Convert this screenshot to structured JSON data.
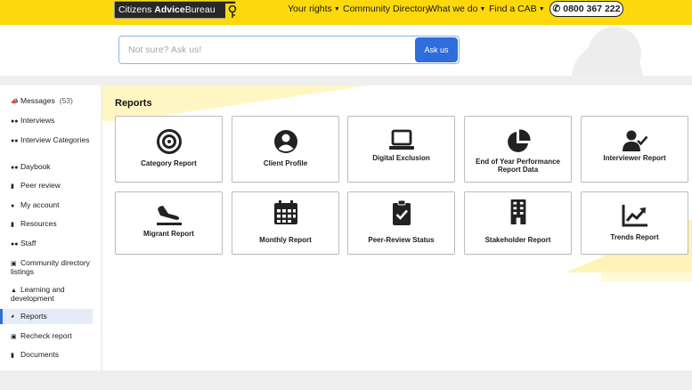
{
  "header": {
    "logo_light": "Citizens ",
    "logo_bold": "Advice",
    "logo_rest": "Bureau",
    "nav": [
      {
        "label": "Your rights",
        "dropdown": true
      },
      {
        "label": "Community Directory",
        "dropdown": false
      },
      {
        "label": "What we do",
        "dropdown": true
      },
      {
        "label": "Find a CAB",
        "dropdown": true
      }
    ],
    "phone": "0800 367 222",
    "colors": {
      "brand_yellow": "#fdd90b",
      "accent_blue": "#2f6ddc"
    }
  },
  "search": {
    "placeholder": "Not sure? Ask us!",
    "value": "",
    "button_label": "Ask us"
  },
  "sidebar": {
    "items": [
      {
        "label": "Messages",
        "count": "(53)",
        "icon": "megaphone-icon",
        "active": false
      },
      {
        "label": "Interviews",
        "icon": "users-icon",
        "active": false
      },
      {
        "label": "Interview Categories",
        "icon": "users-icon",
        "active": false
      },
      {
        "label": "Daybook",
        "icon": "users-icon",
        "active": false
      },
      {
        "label": "Peer review",
        "icon": "clipboard-icon",
        "active": false
      },
      {
        "label": "My account",
        "icon": "user-icon",
        "active": false
      },
      {
        "label": "Resources",
        "icon": "file-icon",
        "active": false
      },
      {
        "label": "Staff",
        "icon": "users-icon",
        "active": false
      },
      {
        "label": "Community directory listings",
        "icon": "address-book-icon",
        "active": false
      },
      {
        "label": "Learning and development",
        "icon": "graduation-cap-icon",
        "active": false
      },
      {
        "label": "Reports",
        "icon": "pie-chart-icon",
        "active": true
      },
      {
        "label": "Recheck report",
        "icon": "check-square-icon",
        "active": false
      },
      {
        "label": "Documents",
        "icon": "document-icon",
        "active": false
      }
    ]
  },
  "main": {
    "title": "Reports",
    "cards": [
      {
        "label": "Category Report",
        "icon": "bullseye-icon"
      },
      {
        "label": "Client Profile",
        "icon": "user-circle-icon"
      },
      {
        "label": "Digital Exclusion",
        "icon": "laptop-icon"
      },
      {
        "label": "End of Year Performance Report Data",
        "icon": "pie-chart-icon"
      },
      {
        "label": "Interviewer Report",
        "icon": "user-check-icon"
      },
      {
        "label": "Migrant Report",
        "icon": "plane-arrival-icon"
      },
      {
        "label": "Monthly Report",
        "icon": "calendar-icon"
      },
      {
        "label": "Peer-Review Status",
        "icon": "clipboard-check-icon"
      },
      {
        "label": "Stakeholder Report",
        "icon": "building-icon"
      },
      {
        "label": "Trends Report",
        "icon": "chart-line-icon"
      }
    ]
  }
}
